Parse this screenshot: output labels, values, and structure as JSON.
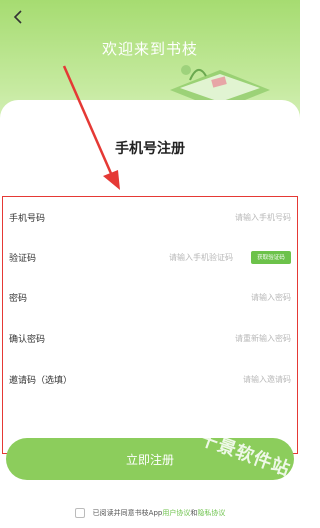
{
  "header": {
    "title": "欢迎来到书枝"
  },
  "page": {
    "title": "手机号注册"
  },
  "form": {
    "fields": [
      {
        "label": "手机号码",
        "placeholder": "请输入手机号码"
      },
      {
        "label": "验证码",
        "placeholder": "请输入手机验证码",
        "button": "获取验证码"
      },
      {
        "label": "密码",
        "placeholder": "请输入密码"
      },
      {
        "label": "确认密码",
        "placeholder": "请重新输入密码"
      },
      {
        "label": "邀请码（选填）",
        "placeholder": "请输入邀请码"
      }
    ]
  },
  "submit_label": "立即注册",
  "agreement": {
    "prefix": "已阅读并同意书枝App",
    "user_link": "用户协议",
    "and": " 和 ",
    "privacy_link": "隐私协议"
  },
  "watermark": "千景软件站",
  "colors": {
    "accent": "#6cc24a",
    "button": "#8ccd5c",
    "highlight": "#e53935"
  },
  "icons": [
    "back-arrow-icon",
    "book-illustration-icon",
    "annotation-arrow-icon"
  ]
}
